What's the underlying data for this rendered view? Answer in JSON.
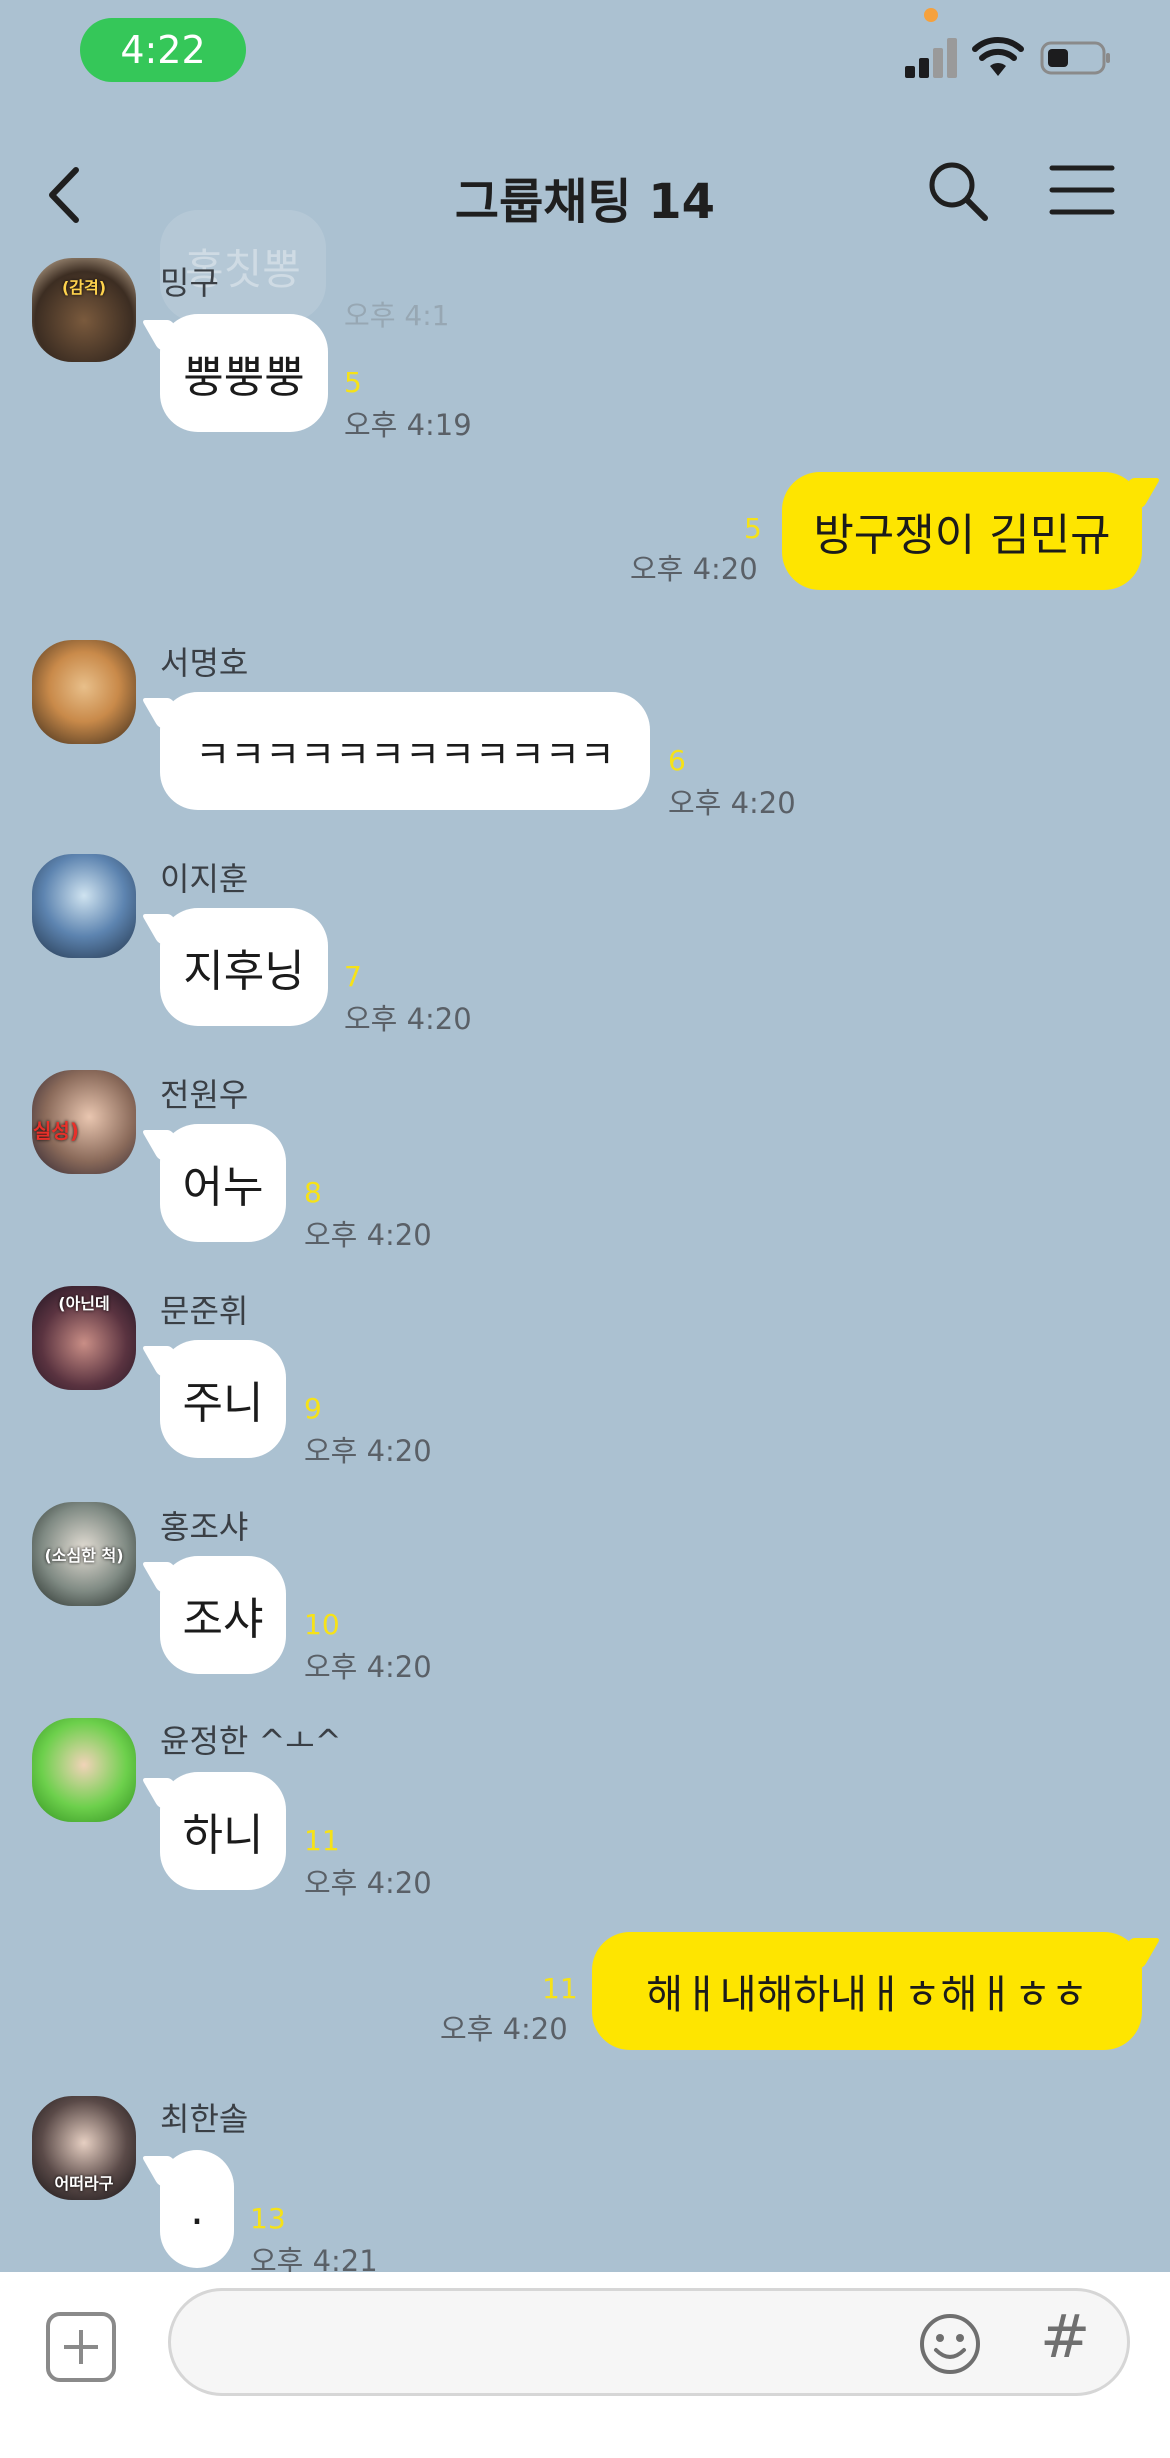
{
  "status_bar": {
    "time": "4:22"
  },
  "header": {
    "title": "그룹채팅 14",
    "hidden_preview": {
      "text": "홍칫뽕",
      "time": "오후 4:1"
    }
  },
  "colors": {
    "background": "#abc1d1",
    "incoming_bubble": "#ffffff",
    "outgoing_bubble": "#fee500",
    "unread_count": "#f6e218",
    "status_pill": "#35c759"
  },
  "messages": [
    {
      "dir": "in",
      "sender": "밍구",
      "avatar_label": "(감격)",
      "text": "뿡뿡뿡",
      "unread": "5",
      "time": "오후 4:19"
    },
    {
      "dir": "out",
      "text": "방구쟁이 김민규",
      "unread": "5",
      "time": "오후 4:20"
    },
    {
      "dir": "in",
      "sender": "서명호",
      "avatar_label": "",
      "text": "ㅋㅋㅋㅋㅋㅋㅋㅋㅋㅋㅋㅋ",
      "unread": "6",
      "time": "오후 4:20"
    },
    {
      "dir": "in",
      "sender": "이지훈",
      "avatar_label": "",
      "text": "지후닝",
      "unread": "7",
      "time": "오후 4:20"
    },
    {
      "dir": "in",
      "sender": "전원우",
      "avatar_label": "실성)",
      "text": "어누",
      "unread": "8",
      "time": "오후 4:20"
    },
    {
      "dir": "in",
      "sender": "문준휘",
      "avatar_label": "(아닌데",
      "text": "주니",
      "unread": "9",
      "time": "오후 4:20"
    },
    {
      "dir": "in",
      "sender": "홍조샤",
      "avatar_label": "(소심한 척)",
      "text": "조샤",
      "unread": "10",
      "time": "오후 4:20"
    },
    {
      "dir": "in",
      "sender": "윤정한 ^ㅗ^",
      "avatar_label": "",
      "text": "하니",
      "unread": "11",
      "time": "오후 4:20"
    },
    {
      "dir": "out",
      "text": "해ㅐ내해하내ㅐㅎ해ㅐㅎㅎ",
      "unread": "11",
      "time": "오후 4:20"
    },
    {
      "dir": "in",
      "sender": "최한솔",
      "avatar_label": "어떠라구",
      "text": ".",
      "unread": "13",
      "time": "오후 4:21"
    }
  ],
  "input": {
    "placeholder": "",
    "hash_label": "#"
  }
}
